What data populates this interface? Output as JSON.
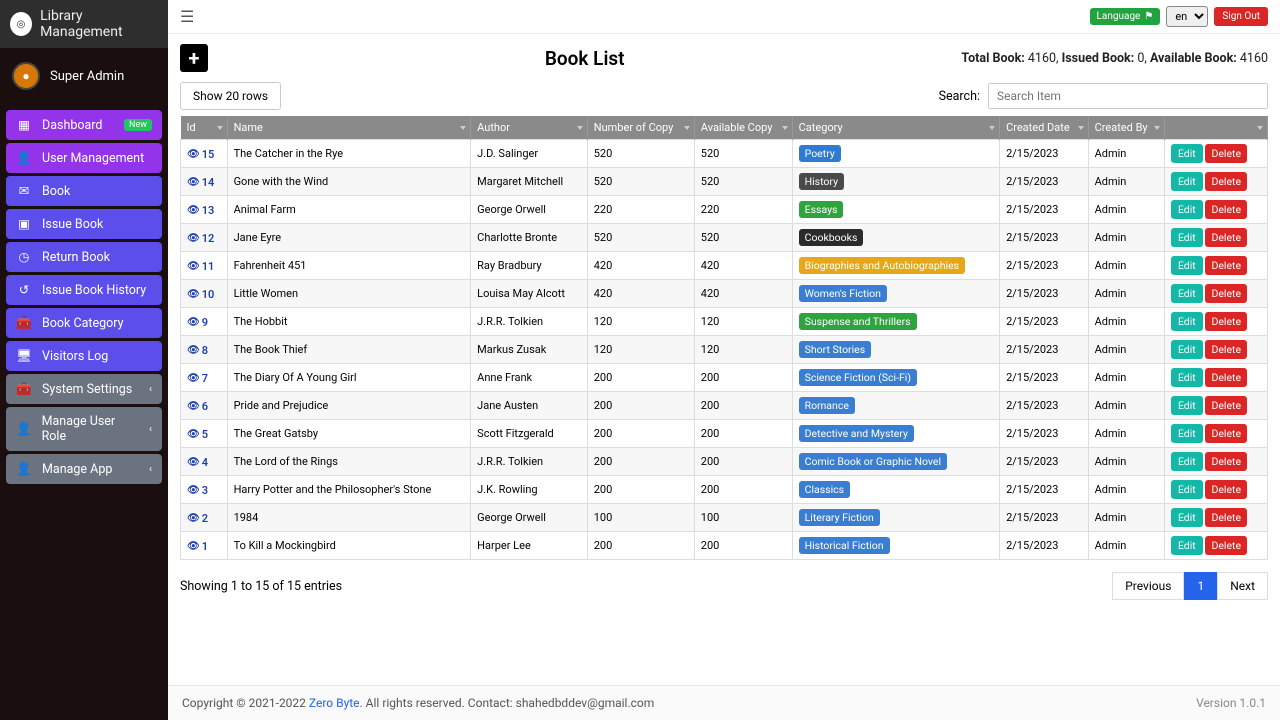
{
  "brand": "Library Management",
  "user": "Super Admin",
  "nav": [
    {
      "label": "Dashboard",
      "color": "purple",
      "badge": "New",
      "icon": "grid"
    },
    {
      "label": "User Management",
      "color": "purple",
      "icon": "user"
    },
    {
      "label": "Book",
      "color": "blue",
      "icon": "mail"
    },
    {
      "label": "Issue Book",
      "color": "blue",
      "icon": "box"
    },
    {
      "label": "Return Book",
      "color": "blue",
      "icon": "clock"
    },
    {
      "label": "Issue Book History",
      "color": "blue",
      "icon": "history"
    },
    {
      "label": "Book Category",
      "color": "blue",
      "icon": "case"
    },
    {
      "label": "Visitors Log",
      "color": "blue",
      "icon": "monitor"
    },
    {
      "label": "System Settings",
      "color": "gray",
      "caret": true,
      "icon": "case"
    },
    {
      "label": "Manage User Role",
      "color": "gray",
      "caret": true,
      "icon": "user"
    },
    {
      "label": "Manage App",
      "color": "gray",
      "caret": true,
      "icon": "user"
    }
  ],
  "topbar": {
    "language": "Language",
    "lang_value": "en",
    "signout": "Sign Out"
  },
  "page_title": "Book List",
  "stats": {
    "total_label": "Total Book:",
    "total": "4160",
    "issued_label": "Issued Book:",
    "issued": "0",
    "avail_label": "Available Book:",
    "avail": "4160"
  },
  "show_rows": "Show 20 rows",
  "search_label": "Search:",
  "search_placeholder": "Search Item",
  "columns": [
    "Id",
    "Name",
    "Author",
    "Number of Copy",
    "Available Copy",
    "Category",
    "Created Date",
    "Created By"
  ],
  "edit_label": "Edit",
  "delete_label": "Delete",
  "rows": [
    {
      "id": "15",
      "name": "The Catcher in the Rye",
      "author": "J.D. Salinger",
      "num": "520",
      "avail": "520",
      "cat": "Poetry",
      "cat_color": "#2f7bd1",
      "date": "2/15/2023",
      "by": "Admin"
    },
    {
      "id": "14",
      "name": "Gone with the Wind",
      "author": "Margaret Mitchell",
      "num": "520",
      "avail": "520",
      "cat": "History",
      "cat_color": "#4a4a4a",
      "date": "2/15/2023",
      "by": "Admin"
    },
    {
      "id": "13",
      "name": "Animal Farm",
      "author": "George Orwell",
      "num": "220",
      "avail": "220",
      "cat": "Essays",
      "cat_color": "#2fa33f",
      "date": "2/15/2023",
      "by": "Admin"
    },
    {
      "id": "12",
      "name": "Jane Eyre",
      "author": "Charlotte Bronte",
      "num": "520",
      "avail": "520",
      "cat": "Cookbooks",
      "cat_color": "#2b2b2b",
      "date": "2/15/2023",
      "by": "Admin"
    },
    {
      "id": "11",
      "name": "Fahrenheit 451",
      "author": "Ray Bradbury",
      "num": "420",
      "avail": "420",
      "cat": "Biographies and Autobiographies",
      "cat_color": "#e6a817",
      "date": "2/15/2023",
      "by": "Admin"
    },
    {
      "id": "10",
      "name": "Little Women",
      "author": "Louisa May Alcott",
      "num": "420",
      "avail": "420",
      "cat": "Women's Fiction",
      "cat_color": "#3a7ed1",
      "date": "2/15/2023",
      "by": "Admin"
    },
    {
      "id": "9",
      "name": "The Hobbit",
      "author": "J.R.R. Tolkien",
      "num": "120",
      "avail": "120",
      "cat": "Suspense and Thrillers",
      "cat_color": "#2fa33f",
      "date": "2/15/2023",
      "by": "Admin"
    },
    {
      "id": "8",
      "name": "The Book Thief",
      "author": "Markus Zusak",
      "num": "120",
      "avail": "120",
      "cat": "Short Stories",
      "cat_color": "#3a7ed1",
      "date": "2/15/2023",
      "by": "Admin"
    },
    {
      "id": "7",
      "name": "The Diary Of A Young Girl",
      "author": "Anne Frank",
      "num": "200",
      "avail": "200",
      "cat": "Science Fiction (Sci-Fi)",
      "cat_color": "#3a7ed1",
      "date": "2/15/2023",
      "by": "Admin"
    },
    {
      "id": "6",
      "name": "Pride and Prejudice",
      "author": "Jane Austen",
      "num": "200",
      "avail": "200",
      "cat": "Romance",
      "cat_color": "#3a7ed1",
      "date": "2/15/2023",
      "by": "Admin"
    },
    {
      "id": "5",
      "name": "The Great Gatsby",
      "author": "Scott Fitzgerald",
      "num": "200",
      "avail": "200",
      "cat": "Detective and Mystery",
      "cat_color": "#3a7ed1",
      "date": "2/15/2023",
      "by": "Admin"
    },
    {
      "id": "4",
      "name": "The Lord of the Rings",
      "author": "J.R.R. Tolkien",
      "num": "200",
      "avail": "200",
      "cat": "Comic Book or Graphic Novel",
      "cat_color": "#3a7ed1",
      "date": "2/15/2023",
      "by": "Admin"
    },
    {
      "id": "3",
      "name": "Harry Potter and the Philosopher's Stone",
      "author": "J.K. Rowling",
      "num": "200",
      "avail": "200",
      "cat": "Classics",
      "cat_color": "#3a7ed1",
      "date": "2/15/2023",
      "by": "Admin"
    },
    {
      "id": "2",
      "name": "1984",
      "author": "George Orwell",
      "num": "100",
      "avail": "100",
      "cat": "Literary Fiction",
      "cat_color": "#3a7ed1",
      "date": "2/15/2023",
      "by": "Admin"
    },
    {
      "id": "1",
      "name": "To Kill a Mockingbird",
      "author": "Harper Lee",
      "num": "200",
      "avail": "200",
      "cat": "Historical Fiction",
      "cat_color": "#3a7ed1",
      "date": "2/15/2023",
      "by": "Admin"
    }
  ],
  "showing": "Showing 1 to 15 of 15 entries",
  "pager": {
    "prev": "Previous",
    "page": "1",
    "next": "Next"
  },
  "footer": {
    "copy": "Copyright © 2021-2022 ",
    "zb": "Zero Byte.",
    "rest": " All rights reserved. Contact: shahedbddev@gmail.com",
    "version": "Version 1.0.1"
  }
}
